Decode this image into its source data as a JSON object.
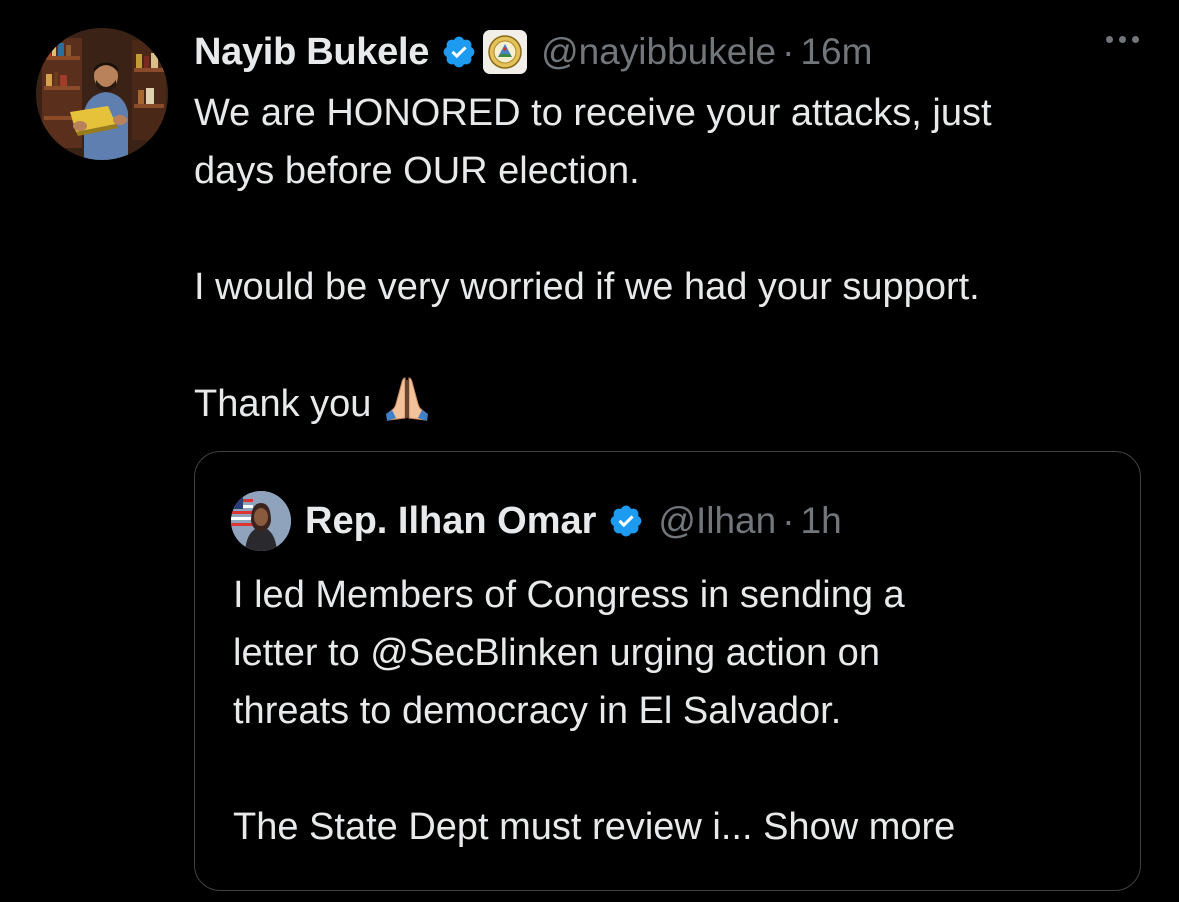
{
  "tweet": {
    "author": {
      "display_name": "Nayib Bukele",
      "handle": "@nayibbukele",
      "verified_icon": "verified-badge-icon",
      "affiliation_icon": "el-salvador-coat-of-arms-icon"
    },
    "separator": "·",
    "time": "16m",
    "more_icon": "more-options-icon",
    "text_lines": {
      "p1_line1": "We are HONORED to receive your attacks, just",
      "p1_line2": "days before OUR election.",
      "p2": "I would be very worried if we had your support.",
      "p3": "Thank you"
    },
    "emoji": "folded-hands-icon"
  },
  "quoted_tweet": {
    "author": {
      "display_name": "Rep. Ilhan Omar",
      "handle": "@Ilhan",
      "verified_icon": "verified-badge-icon"
    },
    "separator": "·",
    "time": "1h",
    "text_lines": {
      "line1": "I led Members of Congress in sending a",
      "line2": "letter to @SecBlinken urging action on",
      "line3": "threats to democracy in El Salvador.",
      "line4": "The State Dept must review i... Show more"
    }
  },
  "colors": {
    "background": "#000000",
    "text_primary": "#e7e9ea",
    "text_secondary": "#71767b",
    "verified_blue": "#1d9bf0",
    "border": "#3e4144"
  }
}
